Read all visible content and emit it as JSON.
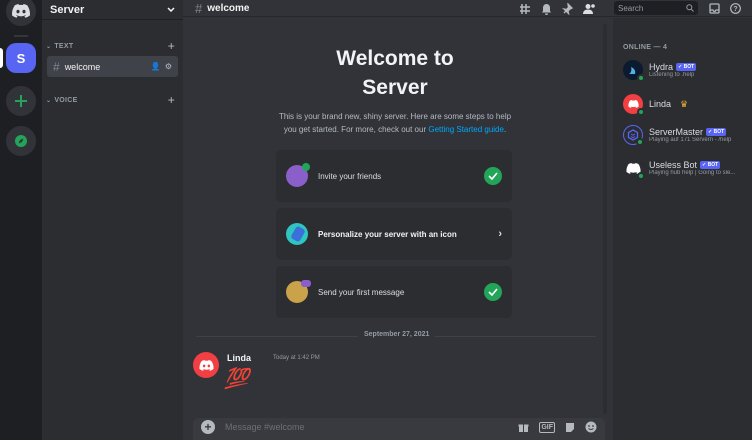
{
  "server": {
    "name": "Server",
    "initial": "S"
  },
  "categories": {
    "text": "TEXT",
    "voice": "VOICE"
  },
  "channel": {
    "name": "welcome"
  },
  "topbar": {
    "channel": "welcome",
    "search_placeholder": "Search"
  },
  "welcome": {
    "title_line1": "Welcome to",
    "title_line2": "Server",
    "sub_line1": "This is your brand new, shiny server. Here are some steps to help",
    "sub_line2": "you get started. For more, check out our",
    "sub_link": "Getting Started guide",
    "sub_end": "."
  },
  "steps": [
    {
      "label": "Invite your friends",
      "done": true
    },
    {
      "label": "Personalize your server with an icon",
      "done": false
    },
    {
      "label": "Send your first message",
      "done": true
    }
  ],
  "divider_date": "September 27, 2021",
  "message": {
    "author": "Linda",
    "time": "Today at 1:42 PM",
    "content": "💯"
  },
  "composer": {
    "placeholder": "Message #welcome",
    "gif": "GIF"
  },
  "members": {
    "header": "ONLINE — 4",
    "bot_tag": "BOT",
    "list": [
      {
        "name": "Hydra",
        "bot": true,
        "status": "Listening to .help"
      },
      {
        "name": "Linda",
        "bot": false,
        "status": ""
      },
      {
        "name": "ServerMaster",
        "bot": true,
        "status": "Playing auf 171 Servern - /help"
      },
      {
        "name": "Useless Bot",
        "bot": true,
        "status": "Playing hub help | Going to sle..."
      }
    ]
  },
  "colors": {
    "brand": "#5865f2",
    "online": "#23a559",
    "link": "#00a8fc"
  }
}
